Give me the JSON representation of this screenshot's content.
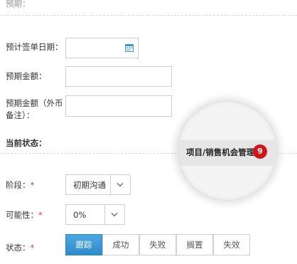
{
  "sections": {
    "expected": "预期：",
    "current_status": "当前状态："
  },
  "fields": {
    "sign_date": {
      "label": "预计签单日期：",
      "value": "",
      "icon": "calendar-icon"
    },
    "amount": {
      "label": "预期金额：",
      "value": ""
    },
    "amount_note": {
      "label_line1": "预期金额（外币",
      "label_line2": "备注）：",
      "value": ""
    }
  },
  "status": {
    "stage": {
      "label": "阶段：",
      "required_mark": "*",
      "value": "初期沟通"
    },
    "probability": {
      "label": "可能性：",
      "required_mark": "*",
      "value": "0%"
    },
    "state": {
      "label": "状态：",
      "required_mark": "*",
      "options": [
        "跟踪",
        "成功",
        "失败",
        "搁置",
        "失效"
      ],
      "active_index": 0
    }
  },
  "magnifier": {
    "text": "项目/销售机会管理",
    "badge": "9"
  },
  "colors": {
    "accent": "#3a97d4",
    "required": "#e23b3b",
    "badge": "#d3151b"
  }
}
